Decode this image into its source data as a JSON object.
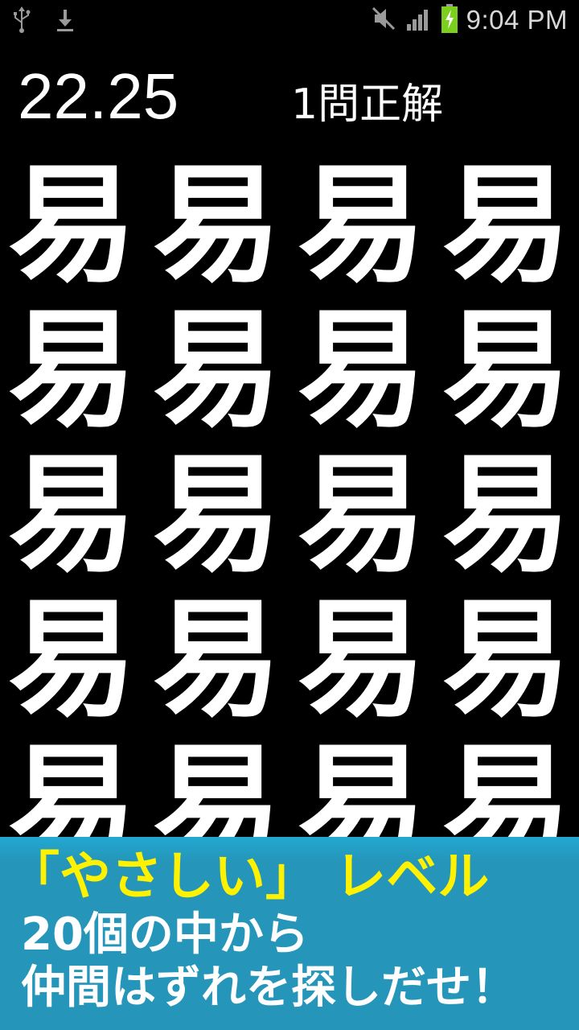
{
  "status_bar": {
    "time": "9:04 PM",
    "icons": [
      "usb-icon",
      "download-icon",
      "mute-icon",
      "signal-icon",
      "battery-charging-icon"
    ]
  },
  "game": {
    "timer": "22.25",
    "score": "1問正解",
    "tile_char": "易",
    "tiles": [
      "易",
      "易",
      "易",
      "易",
      "易",
      "易",
      "易",
      "易",
      "易",
      "易",
      "易",
      "易",
      "易",
      "易",
      "易",
      "易",
      "易",
      "易",
      "易",
      "易"
    ]
  },
  "banner": {
    "line1": "「やさしい」 レベル",
    "line2": "20個の中から",
    "line3": "仲間はずれを探しだせ！"
  },
  "colors": {
    "background": "#000000",
    "text": "#ffffff",
    "banner_bg": "#2596ba",
    "banner_highlight": "#fff200",
    "battery_green": "#7ccf1f"
  }
}
